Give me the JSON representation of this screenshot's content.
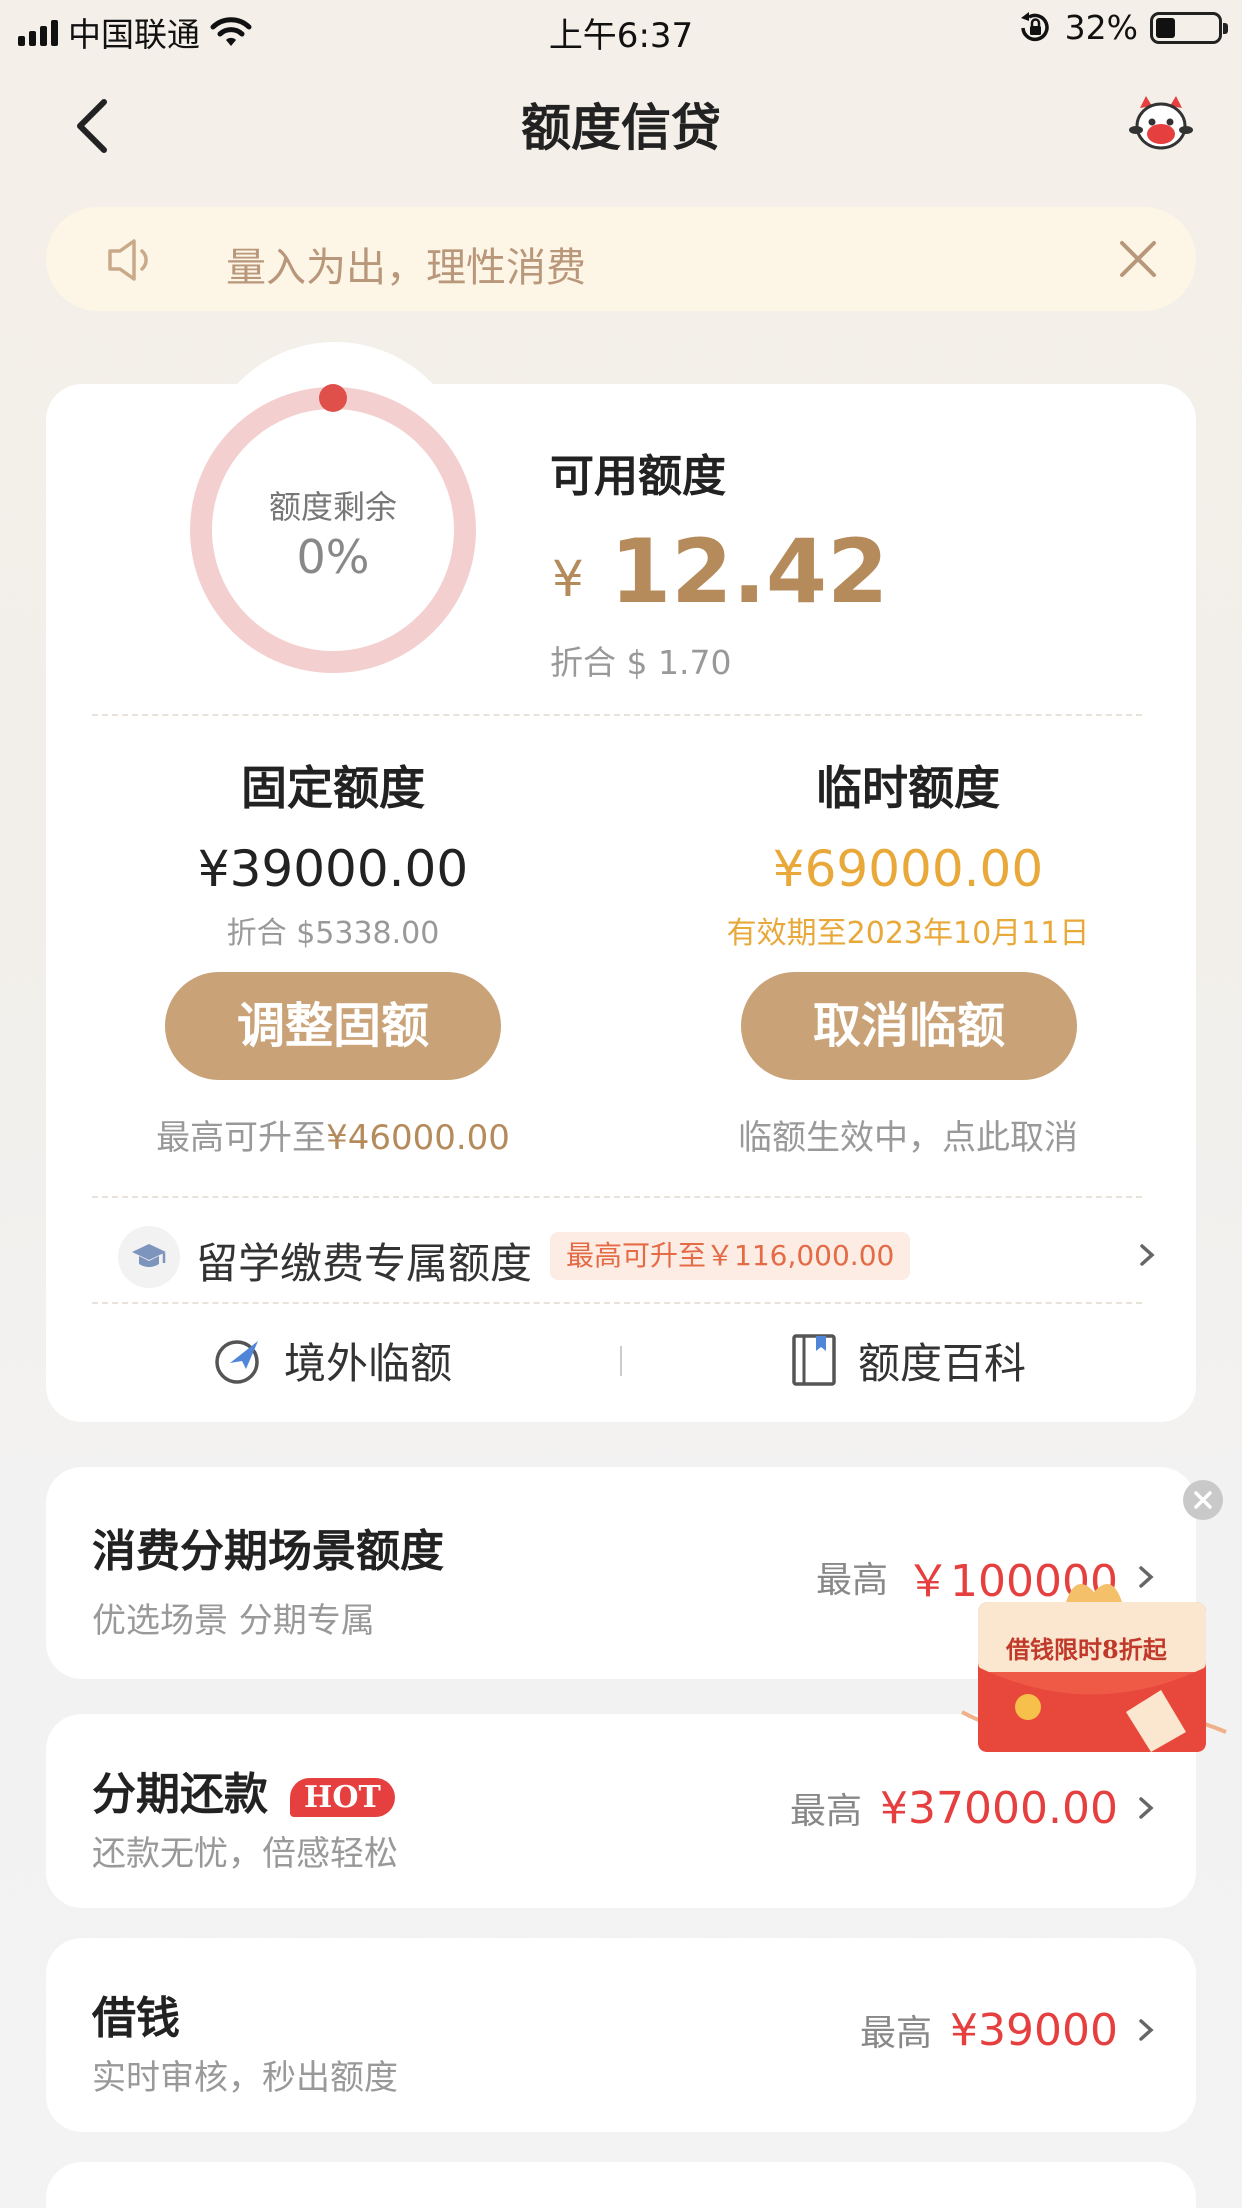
{
  "status_bar": {
    "carrier": "中国联通",
    "time": "上午6:37",
    "battery": "32%",
    "battery_level": 0.32
  },
  "nav": {
    "title": "额度信贷"
  },
  "notice": {
    "text": "量入为出，理性消费"
  },
  "credit": {
    "ring_label": "额度剩余",
    "ring_value": "0%",
    "available_title": "可用额度",
    "currency_symbol": "¥",
    "available_amount": "12.42",
    "converted": "折合 $ 1.70"
  },
  "fixed": {
    "title": "固定额度",
    "amount": "¥39000.00",
    "converted": "折合 $5338.00",
    "button": "调整固额",
    "foot_prefix": "最高可升至",
    "foot_amount": "¥46000.00"
  },
  "temp": {
    "title": "临时额度",
    "amount": "¥69000.00",
    "validity": "有效期至2023年10月11日",
    "button": "取消临额",
    "foot": "临额生效中，点此取消"
  },
  "study": {
    "label": "留学缴费专属额度",
    "tag": "最高可升至￥116,000.00"
  },
  "links": {
    "overseas": "境外临额",
    "wiki": "额度百科"
  },
  "list": [
    {
      "title": "消费分期场景额度",
      "sub": "优选场景 分期专属",
      "label": "最高",
      "value": "￥100000"
    },
    {
      "title": "分期还款",
      "hot": "HOT",
      "sub": "还款无忧，倍感轻松",
      "label": "最高",
      "value": "¥37000.00"
    },
    {
      "title": "借钱",
      "sub": "实时审核，秒出额度",
      "label": "最高",
      "value": "¥39000"
    }
  ],
  "promo": {
    "text": "借钱限时8折起"
  },
  "colors": {
    "gold": "#c9a277",
    "gold_text": "#b58b5c",
    "orange": "#e8a93a",
    "red": "#e5403f"
  }
}
